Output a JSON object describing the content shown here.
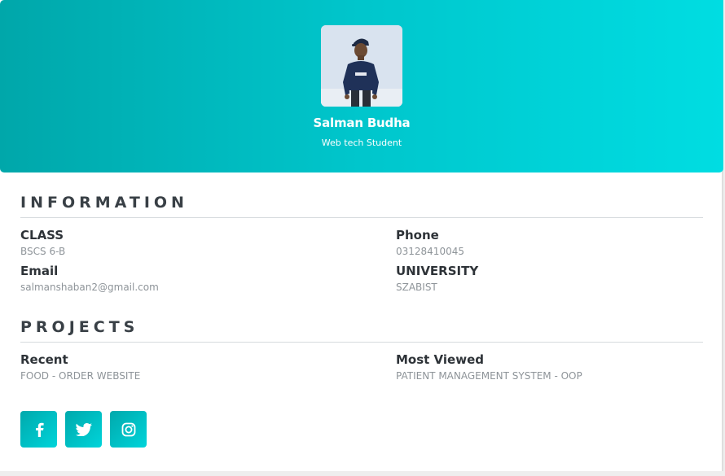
{
  "profile": {
    "name": "Salman Budha",
    "role": "Web tech Student",
    "avatar_icon": "profile-photo"
  },
  "information": {
    "title": "INFORMATION",
    "fields": [
      {
        "label": "CLASS",
        "value": "BSCS 6-B"
      },
      {
        "label": "Phone",
        "value": "03128410045"
      },
      {
        "label": "Email",
        "value": "salmanshaban2@gmail.com"
      },
      {
        "label": "UNIVERSITY",
        "value": "SZABIST"
      }
    ]
  },
  "projects": {
    "title": "PROJECTS",
    "fields": [
      {
        "label": "Recent",
        "value": "FOOD - ORDER WEBSITE"
      },
      {
        "label": "Most Viewed",
        "value": "PATIENT MANAGEMENT SYSTEM - OOP"
      }
    ]
  },
  "social": [
    {
      "icon": "facebook-icon"
    },
    {
      "icon": "twitter-icon"
    },
    {
      "icon": "instagram-icon"
    }
  ],
  "colors": {
    "header_start": "#00a7aa",
    "header_end": "#00dde2",
    "heading_text": "#394046",
    "muted_text": "#8e9499"
  }
}
